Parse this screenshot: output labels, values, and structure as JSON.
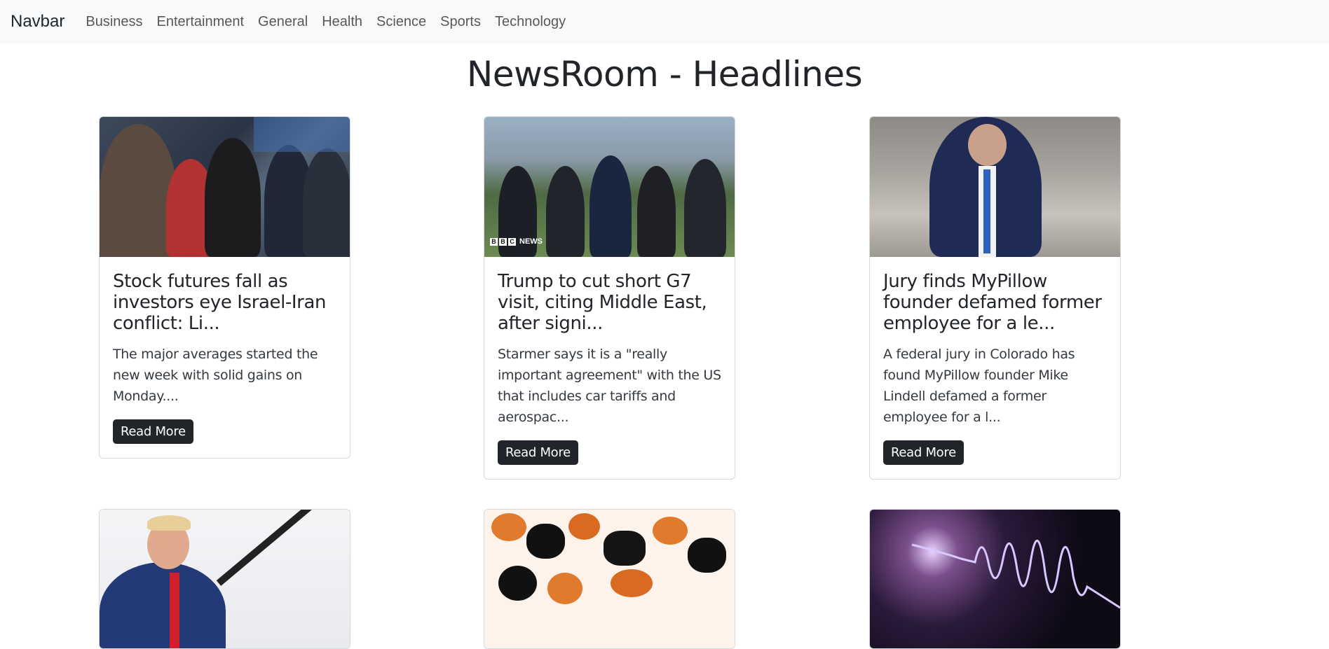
{
  "navbar": {
    "brand": "Navbar",
    "links": [
      "Business",
      "Entertainment",
      "General",
      "Health",
      "Science",
      "Sports",
      "Technology"
    ]
  },
  "page": {
    "title": "NewsRoom - Headlines"
  },
  "cards": [
    {
      "title": "Stock futures fall as investors eye Israel-Iran conflict: Li...",
      "description": "The major averages started the new week with solid gains on Monday....",
      "button": "Read More"
    },
    {
      "title": "Trump to cut short G7 visit, citing Middle East, after signi...",
      "description": "Starmer says it is a \"really important agreement\" with the US that includes car tariffs and aerospac...",
      "button": "Read More",
      "image_watermark": [
        "B",
        "B",
        "C",
        "NEWS"
      ]
    },
    {
      "title": "Jury finds MyPillow founder defamed former employee for a le...",
      "description": "A federal jury in Colorado has found MyPillow founder Mike Lindell defamed a former employee for a l...",
      "button": "Read More"
    }
  ]
}
